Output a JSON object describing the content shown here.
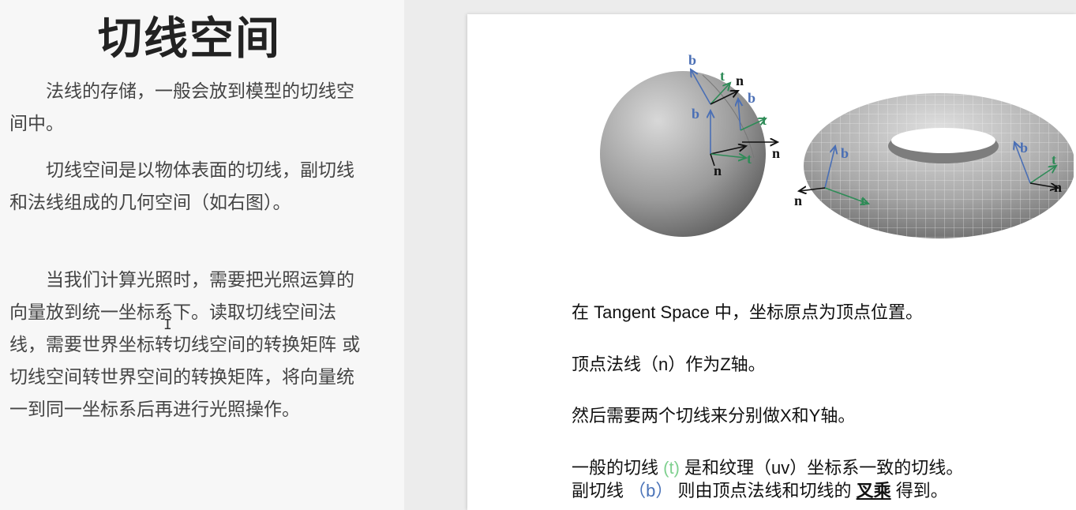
{
  "left": {
    "title": "切线空间",
    "paragraphs": [
      "法线的存储，一般会放到模型的切线空间中。",
      "切线空间是以物体表面的切线，副切线和法线组成的几何空间（如右图）。",
      "当我们计算光照时，需要把光照运算的向量放到统一坐标系下。读取切线空间法线，需要世界坐标转切线空间的转换矩阵 或 切线空间转世界空间的转换矩阵，将向量统一到同一坐标系后再进行光照操作。"
    ]
  },
  "diagram": {
    "labels": {
      "b": "b",
      "t": "t",
      "n": "n"
    }
  },
  "slide": {
    "line1": "在 Tangent Space 中，坐标原点为顶点位置。",
    "line2": "顶点法线（n）作为Z轴。",
    "line3": "然后需要两个切线来分别做X和Y轴。",
    "line4": {
      "a": "一般的切线 ",
      "t": "(t)",
      "b": " 是和纹理（uv）坐标系一致的切线。"
    },
    "line5": {
      "a": "副切线 ",
      "b_label": "（b）",
      "c": " 则由顶点法线和切线的 ",
      "bold": "叉乘",
      "d": " 得到。"
    }
  },
  "colors": {
    "tangent": "#2e8b57",
    "bitangent": "#4a6fb5",
    "normal": "#111111"
  },
  "cursor_icon": "text-ibeam-icon"
}
